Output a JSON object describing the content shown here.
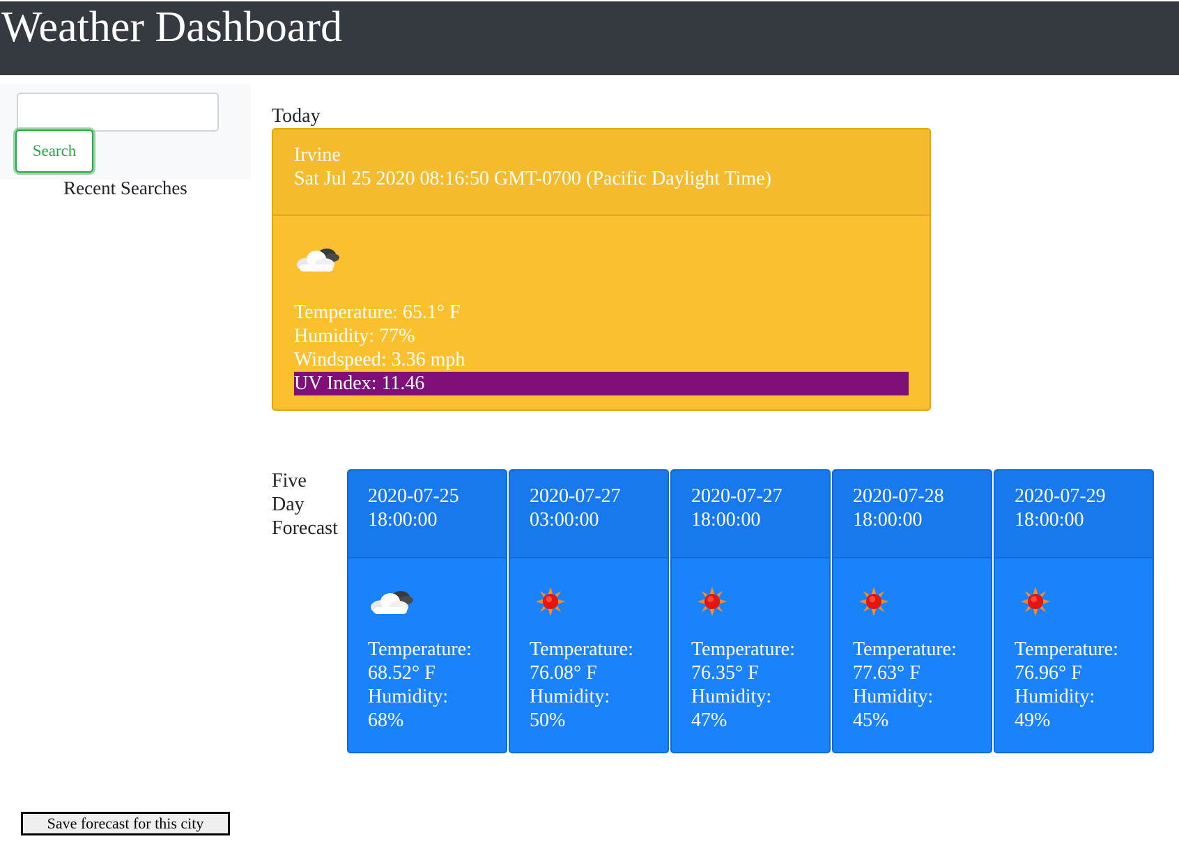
{
  "header": {
    "title": "Weather Dashboard"
  },
  "sidebar": {
    "search_value": "",
    "search_button": "Search",
    "recent_title": "Recent Searches"
  },
  "today": {
    "label": "Today",
    "city": "Irvine",
    "datetime": "Sat Jul 25 2020 08:16:50 GMT-0700 (Pacific Daylight Time)",
    "icon": "cloud-icon",
    "temperature": "Temperature: 65.1° F",
    "humidity": "Humidity: 77%",
    "windspeed": "Windspeed: 3.36 mph",
    "uv": "UV Index: 11.46",
    "colors": {
      "card": "#fbc02d",
      "uv_bar": "#800f7a"
    }
  },
  "forecast": {
    "label_line1": "Five",
    "label_line2": "Day",
    "label_line3": "Forecast",
    "card_color": "#1a82fb",
    "days": [
      {
        "date": "2020-07-25",
        "time": "18:00:00",
        "icon": "cloud-icon",
        "temp_label": "Temperature:",
        "temp": "68.52° F",
        "hum_label": "Humidity:",
        "hum": "68%"
      },
      {
        "date": "2020-07-27",
        "time": "03:00:00",
        "icon": "sun-icon",
        "temp_label": "Temperature:",
        "temp": "76.08° F",
        "hum_label": "Humidity:",
        "hum": "50%"
      },
      {
        "date": "2020-07-27",
        "time": "18:00:00",
        "icon": "sun-icon",
        "temp_label": "Temperature:",
        "temp": "76.35° F",
        "hum_label": "Humidity:",
        "hum": "47%"
      },
      {
        "date": "2020-07-28",
        "time": "18:00:00",
        "icon": "sun-icon",
        "temp_label": "Temperature:",
        "temp": "77.63° F",
        "hum_label": "Humidity:",
        "hum": "45%"
      },
      {
        "date": "2020-07-29",
        "time": "18:00:00",
        "icon": "sun-icon",
        "temp_label": "Temperature:",
        "temp": "76.96° F",
        "hum_label": "Humidity:",
        "hum": "49%"
      }
    ]
  },
  "footer": {
    "save_button": "Save forecast for this city"
  }
}
